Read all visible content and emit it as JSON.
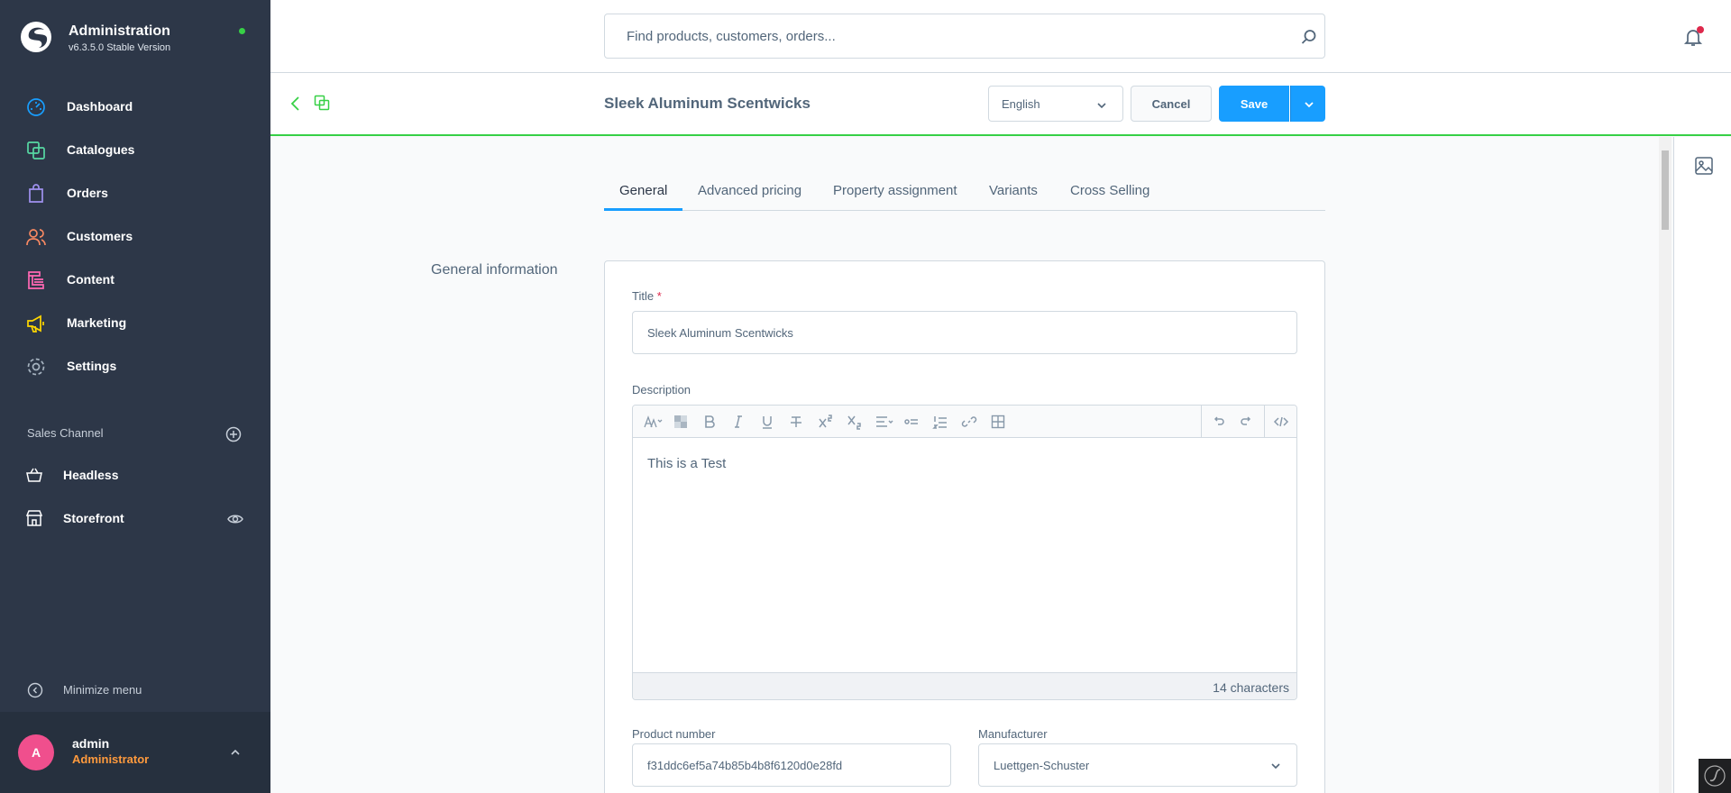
{
  "brand": {
    "title": "Administration",
    "version": "v6.3.5.0 Stable Version",
    "colors": {
      "online_dot": "#37d046"
    }
  },
  "nav": [
    {
      "label": "Dashboard",
      "icon": "dashboard-icon",
      "color": "#189eff"
    },
    {
      "label": "Catalogues",
      "icon": "catalogues-icon",
      "color": "#57d9a3"
    },
    {
      "label": "Orders",
      "icon": "orders-icon",
      "color": "#a092f0"
    },
    {
      "label": "Customers",
      "icon": "customers-icon",
      "color": "#f88962"
    },
    {
      "label": "Content",
      "icon": "content-icon",
      "color": "#ff68b4"
    },
    {
      "label": "Marketing",
      "icon": "marketing-icon",
      "color": "#ffd700"
    },
    {
      "label": "Settings",
      "icon": "settings-icon",
      "color": "#a7b4c1"
    }
  ],
  "sales_channel": {
    "heading": "Sales Channel",
    "items": [
      {
        "label": "Headless",
        "icon": "basket-icon"
      },
      {
        "label": "Storefront",
        "icon": "storefront-icon"
      }
    ]
  },
  "sidebar_footer": {
    "minimize_label": "Minimize menu"
  },
  "user": {
    "initial": "A",
    "name": "admin",
    "role": "Administrator"
  },
  "search": {
    "placeholder": "Find products, customers, orders..."
  },
  "smartbar": {
    "title": "Sleek Aluminum Scentwicks",
    "language": "English",
    "cancel_label": "Cancel",
    "save_label": "Save"
  },
  "tabs": [
    {
      "label": "General",
      "active": true
    },
    {
      "label": "Advanced pricing",
      "active": false
    },
    {
      "label": "Property assignment",
      "active": false
    },
    {
      "label": "Variants",
      "active": false
    },
    {
      "label": "Cross Selling",
      "active": false
    }
  ],
  "general": {
    "section_label": "General information",
    "title_label": "Title",
    "required_mark": "*",
    "title_value": "Sleek Aluminum Scentwicks",
    "description_label": "Description",
    "description_text": "This is a Test",
    "char_count": "14 characters",
    "product_number_label": "Product number",
    "product_number_value": "f31ddc6ef5a74b85b4b8f6120d0e28fd",
    "manufacturer_label": "Manufacturer",
    "manufacturer_value": "Luettgen-Schuster"
  },
  "colors": {
    "accent": "#189eff",
    "sidebar_bg": "#2d3748",
    "success_border": "#37d046",
    "notification": "#de294c"
  }
}
